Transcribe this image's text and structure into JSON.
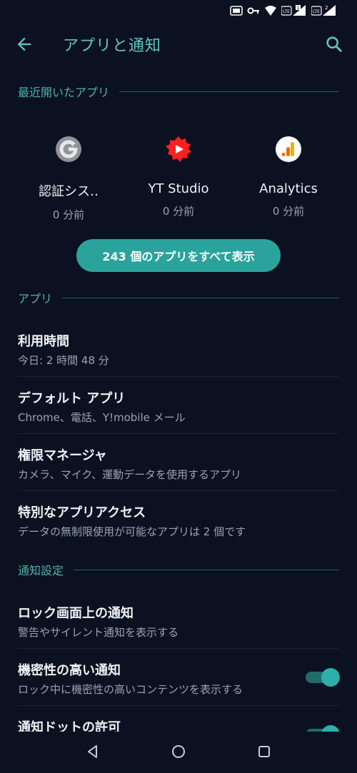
{
  "app_bar": {
    "title": "アプリと通知"
  },
  "status_bar": {
    "sim1": "1",
    "sim2": "2",
    "network": "LTE"
  },
  "recent": {
    "header": "最近開いたアプリ",
    "apps": [
      {
        "name": "認証シス‥",
        "time": "0 分前",
        "icon": "google-authenticator-icon"
      },
      {
        "name": "YT Studio",
        "time": "0 分前",
        "icon": "yt-studio-icon"
      },
      {
        "name": "Analytics",
        "time": "0 分前",
        "icon": "analytics-icon"
      }
    ],
    "show_all_label": "243 個のアプリをすべて表示"
  },
  "apps_section": {
    "header": "アプリ",
    "items": [
      {
        "title": "利用時間",
        "subtitle": "今日: 2 時間 48 分"
      },
      {
        "title": "デフォルト アプリ",
        "subtitle": "Chrome、電話、Y!mobile メール"
      },
      {
        "title": "権限マネージャ",
        "subtitle": "カメラ、マイク、運動データを使用するアプリ"
      },
      {
        "title": "特別なアプリアクセス",
        "subtitle": "データの無制限使用が可能なアプリは 2 個です"
      }
    ]
  },
  "notif_section": {
    "header": "通知設定",
    "items": [
      {
        "title": "ロック画面上の通知",
        "subtitle": "警告やサイレント通知を表示する"
      },
      {
        "title": "機密性の高い通知",
        "subtitle": "ロック中に機密性の高いコンテンツを表示する",
        "toggle_on": true
      },
      {
        "title": "通知ドットの許可",
        "toggle_on": true
      }
    ]
  },
  "colors": {
    "accent": "#2aa39d",
    "background": "#0b1120",
    "header_text": "#4fb3ad"
  }
}
